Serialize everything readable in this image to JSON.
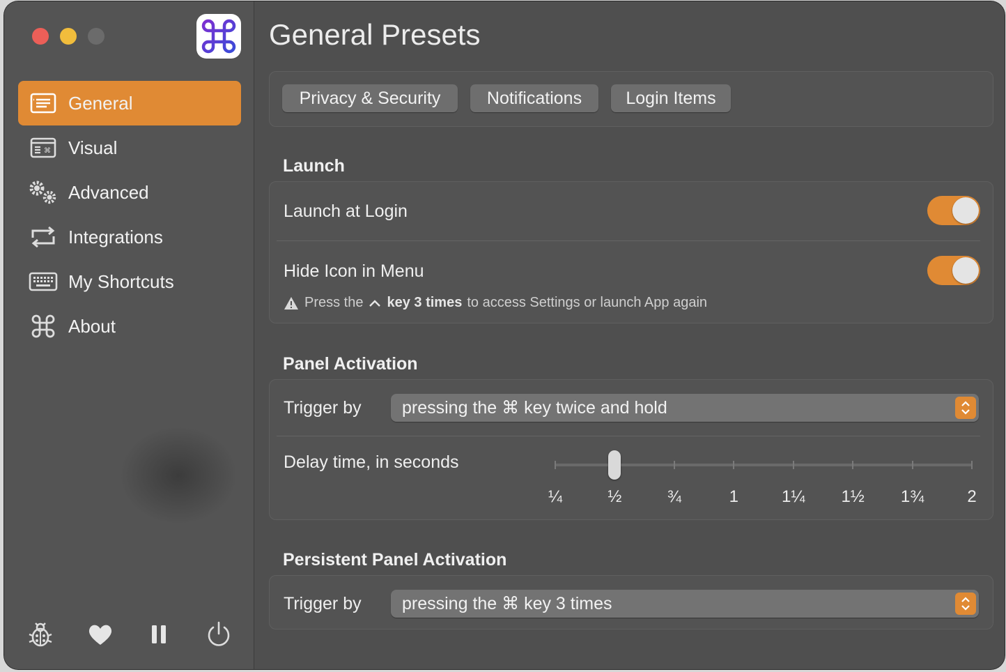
{
  "sidebar": {
    "items": [
      {
        "label": "General",
        "icon": "list-icon",
        "active": true
      },
      {
        "label": "Visual",
        "icon": "keyboard-panel-icon"
      },
      {
        "label": "Advanced",
        "icon": "gears-icon"
      },
      {
        "label": "Integrations",
        "icon": "sync-icon"
      },
      {
        "label": "My Shortcuts",
        "icon": "keyboard-icon"
      },
      {
        "label": "About",
        "icon": "command-icon"
      }
    ],
    "bottom_icons": [
      "bug-icon",
      "heart-icon",
      "pause-icon",
      "power-icon"
    ]
  },
  "main": {
    "title": "General Presets",
    "quick_buttons": [
      "Privacy & Security",
      "Notifications",
      "Login Items"
    ],
    "launch": {
      "title": "Launch",
      "launch_at_login_label": "Launch at Login",
      "launch_at_login_on": true,
      "hide_icon_label": "Hide Icon in Menu",
      "hide_icon_on": true,
      "note_prefix": "Press the",
      "note_key": "key 3 times",
      "note_suffix": "to access Settings or launch App again"
    },
    "panel_activation": {
      "title": "Panel Activation",
      "trigger_label": "Trigger by",
      "trigger_value": "pressing the ⌘ key twice and hold",
      "delay_label": "Delay time, in seconds",
      "delay_ticks": [
        "¼",
        "½",
        "¾",
        "1",
        "1¼",
        "1½",
        "1¾",
        "2"
      ],
      "delay_value": 0.5
    },
    "persistent": {
      "title": "Persistent Panel Activation",
      "trigger_label": "Trigger by",
      "trigger_value": "pressing the ⌘ key 3 times"
    }
  },
  "colors": {
    "accent": "#e08a34",
    "background": "#4f4f4f",
    "sidebar": "#555555"
  }
}
